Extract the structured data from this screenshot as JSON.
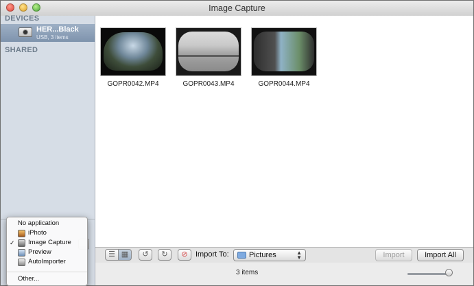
{
  "window": {
    "title": "Image Capture"
  },
  "sidebar": {
    "devices_header": "DEVICES",
    "device": {
      "name": "HER...Black",
      "subtitle": "USB, 3 items"
    },
    "shared_header": "SHARED"
  },
  "files": [
    {
      "name": "GOPR0042.MP4"
    },
    {
      "name": "GOPR0043.MP4"
    },
    {
      "name": "GOPR0044.MP4"
    }
  ],
  "toolbar": {
    "import_to_label": "Import To:",
    "import_to_value": "Pictures",
    "import_button": "Import",
    "import_all_button": "Import All"
  },
  "status": {
    "items_count": "3 items"
  },
  "app_menu": {
    "items": [
      {
        "label": "No application",
        "icon": "",
        "checked": false
      },
      {
        "label": "iPhoto",
        "icon": "iphoto-icon",
        "checked": false
      },
      {
        "label": "Image Capture",
        "icon": "image-capture-icon",
        "checked": true
      },
      {
        "label": "Preview",
        "icon": "preview-icon",
        "checked": false
      },
      {
        "label": "AutoImporter",
        "icon": "autoimporter-icon",
        "checked": false
      },
      {
        "label": "Other...",
        "icon": "",
        "checked": false
      }
    ],
    "check_glyph": "✓"
  },
  "colors": {
    "sidebar_bg": "#d6dde6",
    "selected_device_bg": "#8ea2ba",
    "accent_folder": "#7eaae0"
  }
}
